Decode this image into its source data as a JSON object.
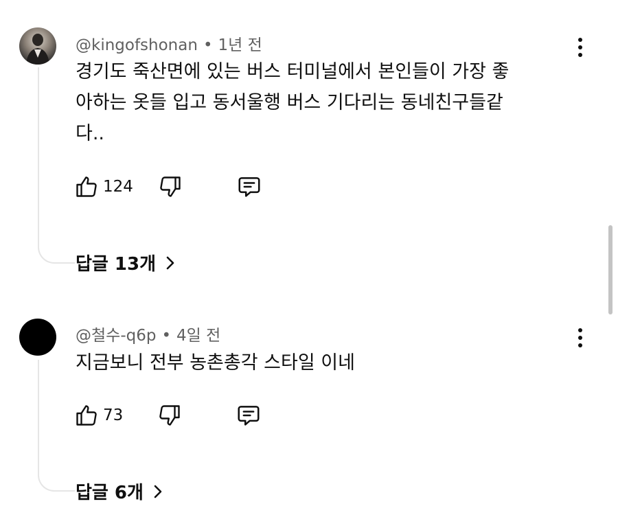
{
  "comments": [
    {
      "handle": "@kingofshonan",
      "time": "1년 전",
      "lines": [
        "경기도 죽산면에 있는 버스 터미널에서 본인들이 가장 좋",
        "아하는 옷들 입고 동서울행 버스 기다리는 동네친구들같",
        "다.."
      ],
      "likes": "124",
      "replies_label": "답글 13개"
    },
    {
      "handle": "@철수-q6p",
      "time": "4일 전",
      "lines": [
        "지금보니 전부 농촌총각 스타일 이네"
      ],
      "likes": "73",
      "replies_label": "답글 6개"
    }
  ],
  "separator": "•",
  "icons": {
    "like": "thumbs-up-icon",
    "dislike": "thumbs-down-icon",
    "reply": "comment-reply-icon",
    "more": "more-vertical-icon",
    "expand": "chevron-right-icon"
  }
}
